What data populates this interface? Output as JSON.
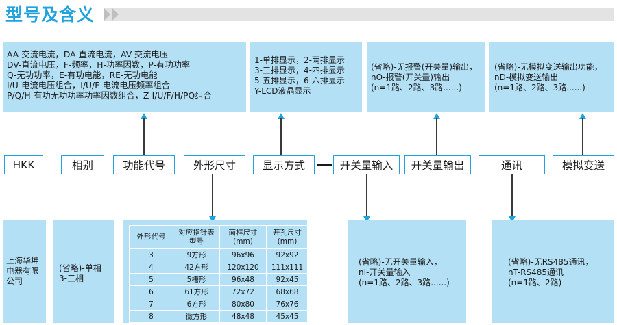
{
  "title": "型号及含义",
  "colors": {
    "accent": "#1fa3dd",
    "box_fill": "#b4e0f6",
    "title_bar": "#e3e3e3"
  },
  "top_boxes": {
    "func": [
      "AA-交流电流，DA-直流电流，AV-交流电压",
      "DV-直流电压，F-频率，H-功率因数，P-有功功率",
      "Q-无功功率，E-有功电能，RE-无功电能",
      "I/U-电流电压组合，I/U/F-电流电压频率组合",
      "P/Q/H-有功无功功率功率因数组合，Z-I/U/F/H/PQ组合"
    ],
    "display": [
      "1-单排显示，2-两排显示",
      "3-三排显示，4-四排显示",
      "5-五排显示，6-六排显示",
      "Y-LCD液晶显示"
    ],
    "switch_out": [
      "(省略)-无报警(开关量)输出，",
      "nO-报警(开关量)输出",
      "(n=1路、2路、3路......)"
    ],
    "analog": [
      "(省略)-无模拟变送输出功能，",
      "nD-模拟变送输出",
      "(n=1路、2路、3路......)"
    ]
  },
  "labels": {
    "hkk": "HKK",
    "phase": "相别",
    "func": "功能代号",
    "size": "外形尺寸",
    "display": "显示方式",
    "dash": "—",
    "switch_in": "开关量输入",
    "switch_out": "开关量输出",
    "comm": "通讯",
    "analog": "模拟变送"
  },
  "bottom_boxes": {
    "maker": [
      "上海华坤",
      "电器有限",
      "公司"
    ],
    "phase": [
      "(省略)-单相",
      "3-三相"
    ],
    "switch_in": [
      "(省略)-无开关量输入，",
      "nI-开关量输入",
      "(n=1路、2路、3路......)"
    ],
    "comm": [
      "(省略)-无RS485通讯，",
      "nT-RS485通讯",
      "(n=1路、2路)"
    ]
  },
  "size_table": {
    "headers": [
      [
        "外形代号"
      ],
      [
        "对应指针表",
        "型号"
      ],
      [
        "面框尺寸",
        "(mm)"
      ],
      [
        "开孔尺寸",
        "(mm)"
      ]
    ],
    "rows": [
      [
        "3",
        "9方形",
        "96x96",
        "92x92"
      ],
      [
        "4",
        "42方形",
        "120x120",
        "111x111"
      ],
      [
        "5",
        "5槽形",
        "96x48",
        "92x45"
      ],
      [
        "6",
        "61方形",
        "72x72",
        "68x68"
      ],
      [
        "7",
        "6方形",
        "80x80",
        "76x76"
      ],
      [
        "8",
        "微方形",
        "48x48",
        "45x45"
      ]
    ]
  }
}
